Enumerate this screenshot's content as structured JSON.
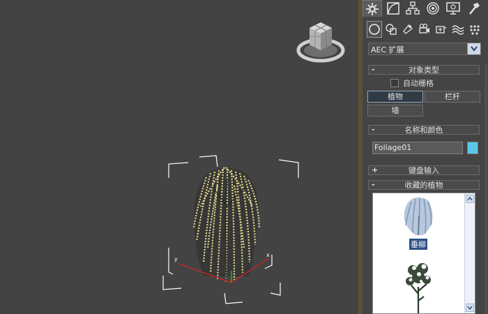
{
  "command_panel": {
    "tabs": [
      {
        "icon": "create-icon",
        "active": true
      },
      {
        "icon": "modify-icon"
      },
      {
        "icon": "hierarchy-icon"
      },
      {
        "icon": "motion-icon"
      },
      {
        "icon": "display-icon"
      },
      {
        "icon": "utilities-icon"
      }
    ],
    "categories": [
      {
        "icon": "geometry-icon",
        "active": true
      },
      {
        "icon": "shapes-icon"
      },
      {
        "icon": "lights-icon"
      },
      {
        "icon": "cameras-icon"
      },
      {
        "icon": "helpers-icon"
      },
      {
        "icon": "space-warps-icon"
      },
      {
        "icon": "systems-icon"
      }
    ],
    "subcategory_dropdown": {
      "value": "AEC 扩展"
    },
    "object_type": {
      "sign": "-",
      "title": "对象类型",
      "autogrid_label": "自动栅格",
      "autogrid_checked": false,
      "buttons": [
        "植物",
        "栏杆",
        "墙"
      ],
      "active_button": "植物"
    },
    "name_color": {
      "sign": "-",
      "title": "名称和颜色",
      "name_value": "Foliage01",
      "color": "#5bc8e8"
    },
    "keyboard_entry": {
      "sign": "+",
      "title": "键盘输入"
    },
    "favorite_plants": {
      "sign": "-",
      "title": "收藏的植物",
      "items": [
        {
          "label": "垂柳",
          "selected": true
        }
      ]
    }
  },
  "colors": {
    "viewport_bg": "#434343",
    "panel_bg": "#444444",
    "divider": "#595136",
    "selection": "#2c4f84",
    "foliage": "#e8dc8a"
  }
}
